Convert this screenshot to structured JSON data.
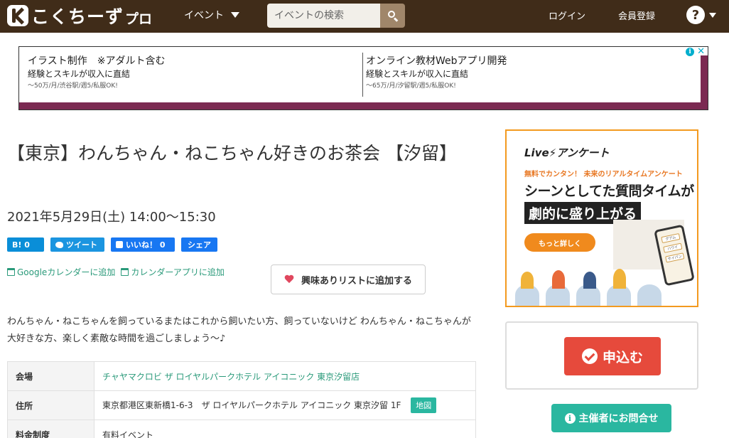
{
  "header": {
    "logo_text": "こくちーず",
    "logo_pro": "プロ",
    "nav_event": "イベント",
    "search_placeholder": "イベントの検索",
    "login": "ログイン",
    "register": "会員登録",
    "help": "?"
  },
  "ad_banner": {
    "items": [
      {
        "title": "イラスト制作　※アダルト含む",
        "sub": "経験とスキルが収入に直結",
        "small": "〜50万/月/渋谷駅/週5/私服OK!"
      },
      {
        "title": "オンライン教材Webアプリ開発",
        "sub": "経験とスキルが収入に直結",
        "small": "〜65万/月/汐留駅/週5/私服OK!"
      }
    ],
    "info_icon": "i",
    "close_icon": "✕"
  },
  "event": {
    "title": "【東京】わんちゃん・ねこちゃん好きのお茶会 【汐留】",
    "date": "2021年5月29日(土) 14:00〜15:30",
    "description": "わんちゃん・ねこちゃんを飼っているまたはこれから飼いたい方、飼っていないけど わんちゃん・ねこちゃんが大好きな方、楽しく素敵な時間を過ごしましょう〜♪"
  },
  "share": {
    "hatena": "B! 0",
    "tweet": "ツイート",
    "like": "いいね！ 0",
    "share": "シェア"
  },
  "calendar": {
    "google": "Googleカレンダーに追加",
    "app": "カレンダーアプリに追加"
  },
  "interest_button": "興味ありリストに追加する",
  "info_table": {
    "rows": [
      {
        "label": "会場",
        "value": "チャヤマクロビ ザ ロイヤルパークホテル アイコニック 東京汐留店"
      },
      {
        "label": "住所",
        "value": "東京都港区東新橋1-6-3　ザ ロイヤルパークホテル アイコニック 東京汐留 1F",
        "map": "地図"
      },
      {
        "label": "料金制度",
        "value": "有料イベント"
      }
    ]
  },
  "side_ad": {
    "brand": "Live⚡アンケート",
    "line1": "無料でカンタン！ 未来のリアルタイムアンケート",
    "line2": "シーンとしてた質問タイムが",
    "line3": "劇的に盛り上がる",
    "more": "もっと詳しく",
    "phone_items": [
      "グアム",
      "ハワイ",
      "サイパン"
    ]
  },
  "apply_button": "申込む",
  "contact_button": "主催者にお問合せ"
}
